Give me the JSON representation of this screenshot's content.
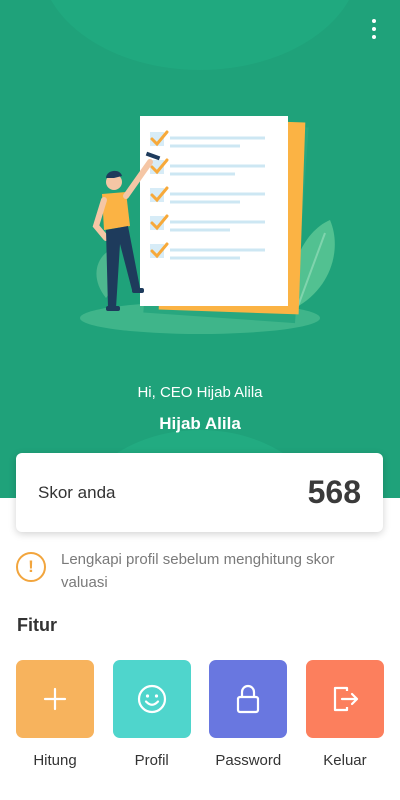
{
  "header": {
    "greeting": "Hi, CEO Hijab Alila",
    "username": "Hijab Alila",
    "menu_icon": "more-vertical-icon",
    "background_color": "#1fa27a"
  },
  "score": {
    "label": "Skor anda",
    "value": "568"
  },
  "notice": {
    "icon": "warning-circle-icon",
    "icon_glyph": "!",
    "text": "Lengkapi profil sebelum menghitung skor valuasi",
    "color": "#f2a53d"
  },
  "features": {
    "title": "Fitur",
    "items": [
      {
        "label": "Hitung",
        "icon": "plus-icon",
        "color": "#f7b35d"
      },
      {
        "label": "Profil",
        "icon": "smiley-icon",
        "color": "#4fd5cc"
      },
      {
        "label": "Password",
        "icon": "lock-icon",
        "color": "#6977e0"
      },
      {
        "label": "Keluar",
        "icon": "logout-icon",
        "color": "#fc7f5d"
      }
    ]
  }
}
